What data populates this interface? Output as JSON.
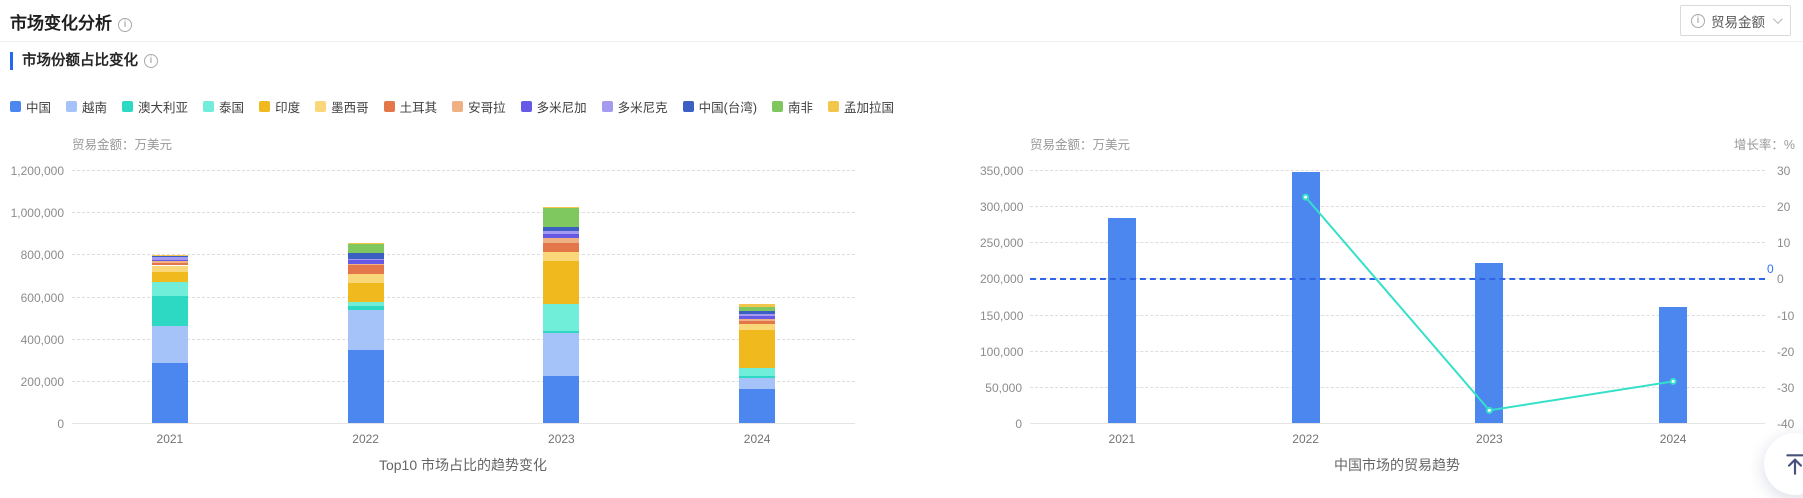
{
  "header": {
    "title": "市场变化分析"
  },
  "toolbar": {
    "metric_selector_label": "贸易金额"
  },
  "section": {
    "title": "市场份额占比变化"
  },
  "colors": {
    "accent_blue": "#2468f2",
    "markline_blue": "#2e65e5",
    "line_teal": "#35e0c8"
  },
  "legend": [
    {
      "label": "中国",
      "color": "#4c87f0"
    },
    {
      "label": "越南",
      "color": "#a5c3f8"
    },
    {
      "label": "澳大利亚",
      "color": "#2ed9c3"
    },
    {
      "label": "泰国",
      "color": "#70eeda"
    },
    {
      "label": "印度",
      "color": "#f0ba1e"
    },
    {
      "label": "墨西哥",
      "color": "#fad778"
    },
    {
      "label": "土耳其",
      "color": "#e4774a"
    },
    {
      "label": "安哥拉",
      "color": "#efb183"
    },
    {
      "label": "多米尼加",
      "color": "#6659e6"
    },
    {
      "label": "多米尼克",
      "color": "#a49af0"
    },
    {
      "label": "中国(台湾)",
      "color": "#3b5fc2"
    },
    {
      "label": "南非",
      "color": "#7fc75f"
    },
    {
      "label": "孟加拉国",
      "color": "#f2c64b"
    }
  ],
  "chart_data": [
    {
      "type": "bar",
      "stacked": true,
      "title": "Top10 市场占比的趋势变化",
      "unit_label": "贸易金额：万美元",
      "categories": [
        "2021",
        "2022",
        "2023",
        "2024"
      ],
      "ylim": [
        0,
        1200000
      ],
      "y_ticks": [
        "1,200,000",
        "1,000,000",
        "800,000",
        "600,000",
        "400,000",
        "200,000",
        "0"
      ],
      "grid": true,
      "legend_position": "top",
      "series": [
        {
          "name": "中国",
          "color": "#4c87f0",
          "values": [
            283000,
            347000,
            222000,
            160000
          ]
        },
        {
          "name": "越南",
          "color": "#a5c3f8",
          "values": [
            178000,
            190000,
            206000,
            55000
          ]
        },
        {
          "name": "澳大利亚",
          "color": "#2ed9c3",
          "values": [
            140000,
            19000,
            10000,
            8000
          ]
        },
        {
          "name": "泰国",
          "color": "#70eeda",
          "values": [
            68000,
            19000,
            127000,
            40000
          ]
        },
        {
          "name": "印度",
          "color": "#f0ba1e",
          "values": [
            48000,
            89000,
            203000,
            180000
          ]
        },
        {
          "name": "墨西哥",
          "color": "#fad778",
          "values": [
            30000,
            44000,
            45000,
            28000
          ]
        },
        {
          "name": "土耳其",
          "color": "#e4774a",
          "values": [
            12000,
            41000,
            43000,
            14000
          ]
        },
        {
          "name": "安哥拉",
          "color": "#efb183",
          "values": [
            8000,
            5000,
            20000,
            10000
          ]
        },
        {
          "name": "多米尼加",
          "color": "#6659e6",
          "values": [
            8000,
            19000,
            19000,
            14000
          ]
        },
        {
          "name": "多米尼克",
          "color": "#a49af0",
          "values": [
            10000,
            5000,
            16000,
            10000
          ]
        },
        {
          "name": "中国(台湾)",
          "color": "#3b5fc2",
          "values": [
            5000,
            30000,
            17000,
            12000
          ]
        },
        {
          "name": "南非",
          "color": "#7fc75f",
          "values": [
            5000,
            44000,
            94000,
            20000
          ]
        },
        {
          "name": "孟加拉国",
          "color": "#f2c64b",
          "values": [
            3000,
            3000,
            4000,
            14000
          ]
        }
      ]
    },
    {
      "type": "bar+line",
      "title": "中国市场的贸易趋势",
      "unit_left": "贸易金额：万美元",
      "unit_right": "增长率：%",
      "categories": [
        "2021",
        "2022",
        "2023",
        "2024"
      ],
      "left_ylim": [
        0,
        350000
      ],
      "left_ticks": [
        "350,000",
        "300,000",
        "250,000",
        "200,000",
        "150,000",
        "100,000",
        "50,000",
        "0"
      ],
      "right_ylim": [
        -40,
        30
      ],
      "right_ticks": [
        "30",
        "20",
        "10",
        "0",
        "-10",
        "-20",
        "-30",
        "-40"
      ],
      "grid": true,
      "bar_series": {
        "name": "贸易金额",
        "color": "#4c87f0",
        "values": [
          283000,
          347000,
          222000,
          160000
        ]
      },
      "line_series": {
        "name": "增长率",
        "color": "#35e0c8",
        "values": [
          null,
          22.5,
          -36.5,
          -28.5
        ]
      },
      "markline": {
        "value": 0,
        "label": "0",
        "color": "#2e65e5"
      }
    }
  ],
  "floating": {
    "back_to_top": "back-to-top"
  }
}
